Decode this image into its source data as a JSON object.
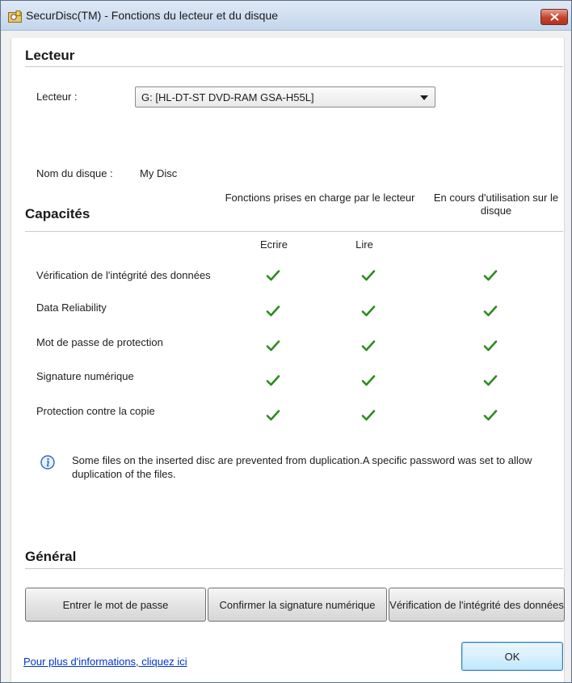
{
  "window": {
    "title": "SecurDisc(TM) - Fonctions du lecteur et du disque"
  },
  "drive_section": {
    "title": "Lecteur",
    "drive_label": "Lecteur :",
    "drive_value": "G: [HL-DT-ST DVD-RAM GSA-H55L]",
    "disc_name_label": "Nom du disque :",
    "disc_name_value": "My Disc"
  },
  "capabilities": {
    "title": "Capacités",
    "col_drive": "Fonctions prises en charge par le lecteur",
    "col_disc": "En cours d'utilisation sur le disque",
    "sub_write": "Ecrire",
    "sub_read": "Lire",
    "rows": [
      {
        "label": "Vérification de l'intégrité des données",
        "write": true,
        "read": true,
        "disc": true
      },
      {
        "label": "Data Reliability",
        "write": true,
        "read": true,
        "disc": true
      },
      {
        "label": "Mot de passe de protection",
        "write": true,
        "read": true,
        "disc": true
      },
      {
        "label": "Signature numérique",
        "write": true,
        "read": true,
        "disc": true
      },
      {
        "label": "Protection contre la copie",
        "write": true,
        "read": true,
        "disc": true
      }
    ],
    "info_message": "Some files on the inserted disc are prevented from duplication.A specific password was set to allow duplication of the files."
  },
  "general": {
    "title": "Général",
    "btn_password": "Entrer le mot de passe",
    "btn_signature": "Confirmer la signature numérique",
    "btn_integrity": "Vérification de l'intégrité des données"
  },
  "footer": {
    "more_info_link": "Pour plus d'informations, cliquez ici",
    "ok_label": "OK"
  },
  "colors": {
    "check": "#2e8b1f",
    "link": "#0033cc",
    "accent": "#3c7fb1"
  },
  "icons": [
    "securdisc-app-icon",
    "close-icon",
    "dropdown-arrow-icon",
    "check-icon",
    "info-icon"
  ]
}
